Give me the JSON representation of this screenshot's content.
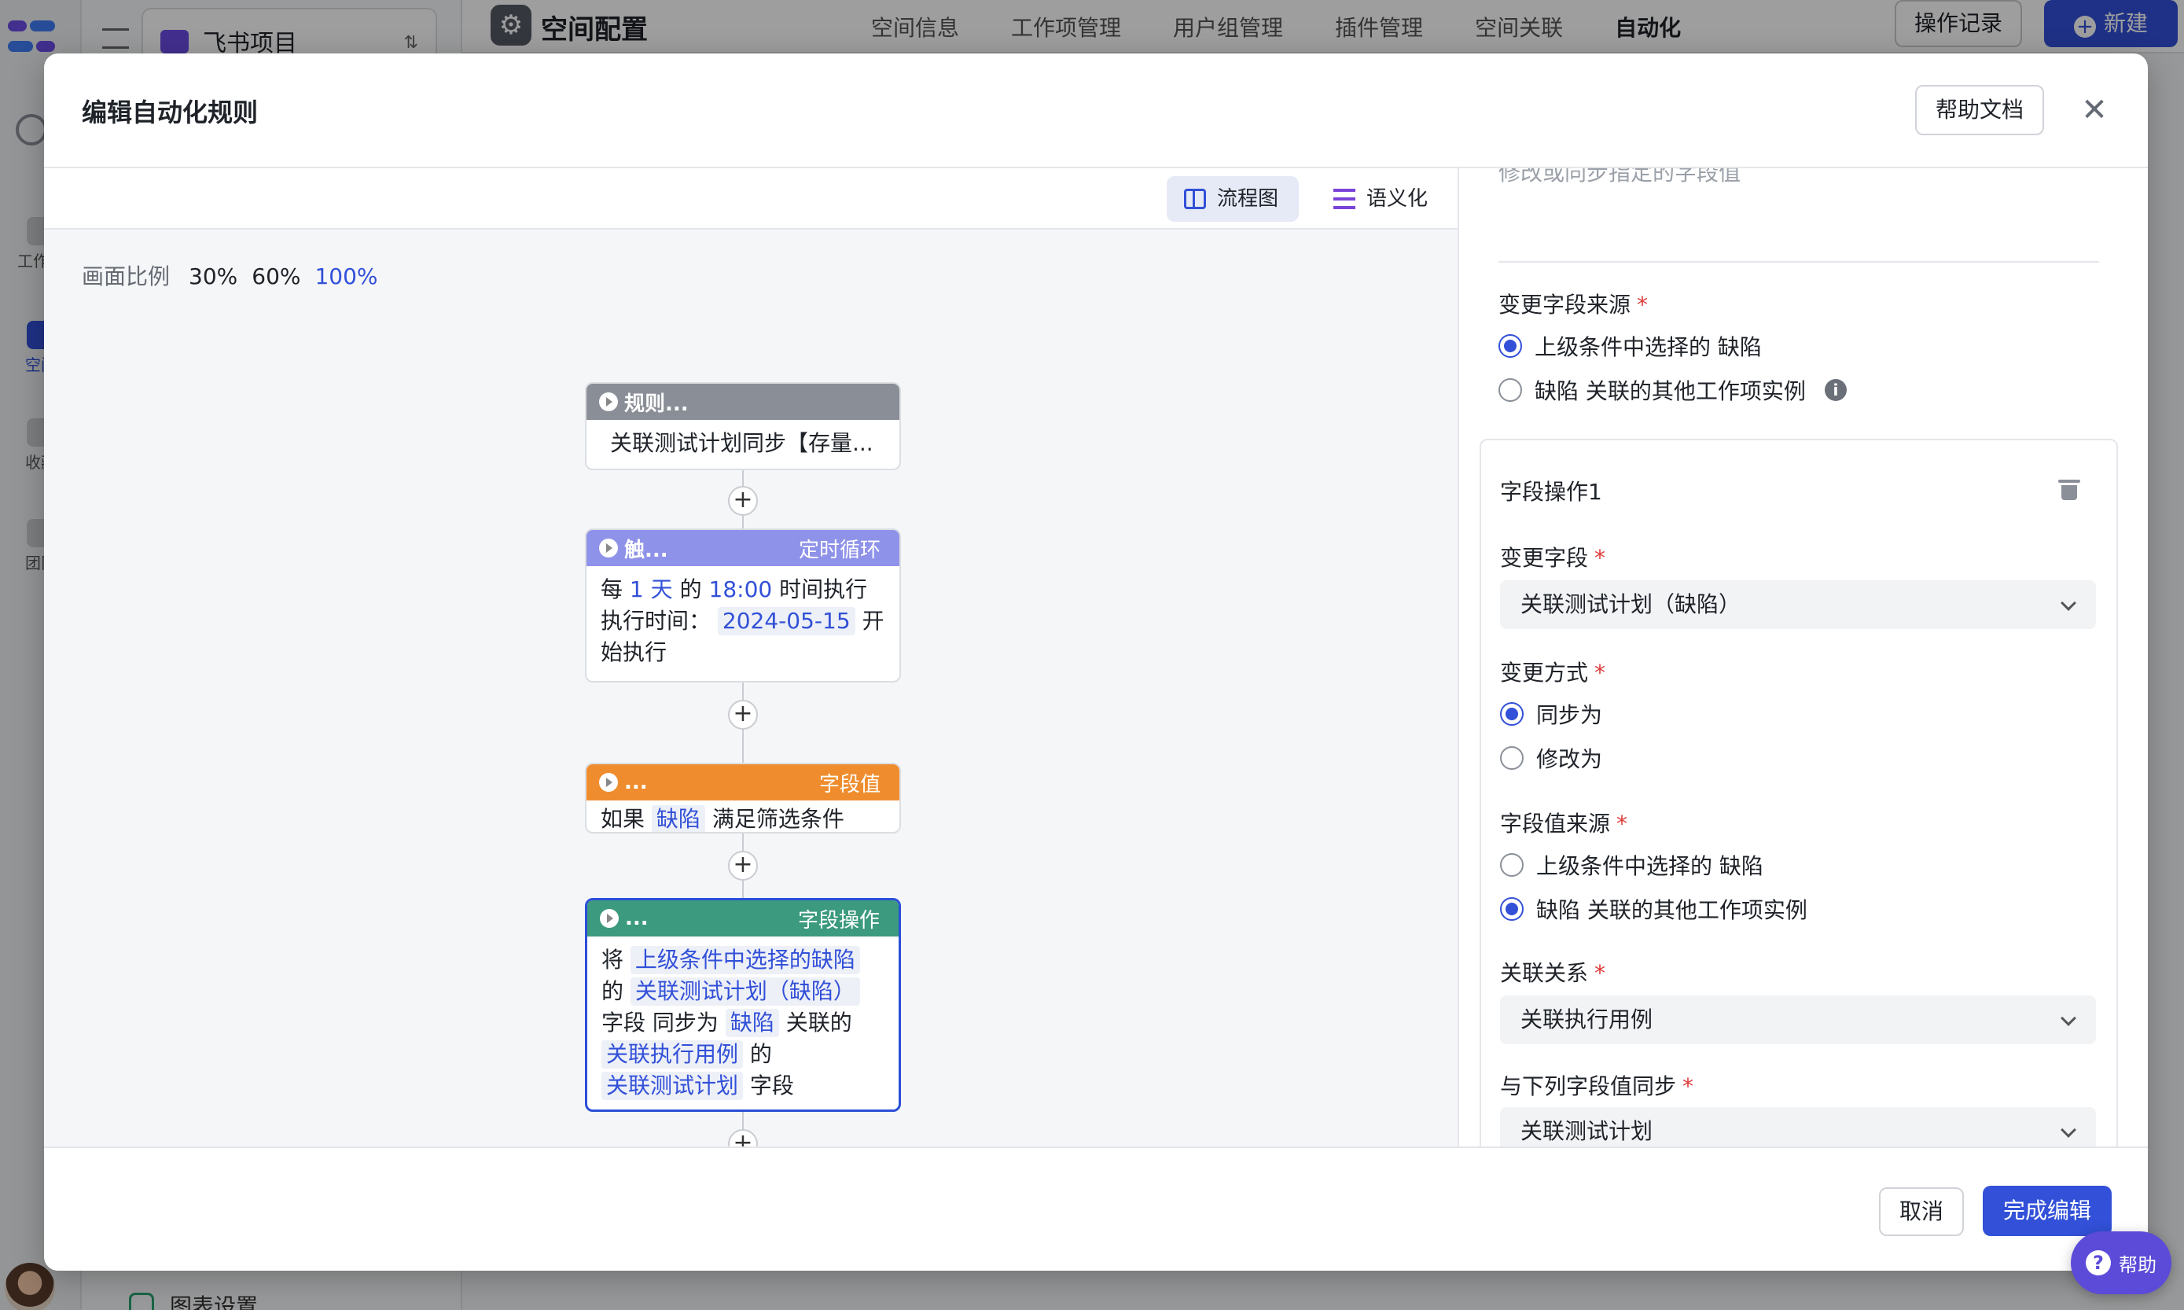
{
  "background": {
    "rail": [
      {
        "label": "工作台"
      },
      {
        "label": "空间"
      },
      {
        "label": "收藏"
      },
      {
        "label": "团队"
      }
    ],
    "project_name": "飞书项目",
    "sidebar_bottom_item": "图表设置",
    "page_title": "空间配置",
    "tabs": [
      {
        "label": "空间信息",
        "active": false
      },
      {
        "label": "工作项管理",
        "active": false
      },
      {
        "label": "用户组管理",
        "active": false
      },
      {
        "label": "插件管理",
        "active": false
      },
      {
        "label": "空间关联",
        "active": false
      },
      {
        "label": "自动化",
        "active": true
      }
    ],
    "op_log_button": "操作记录",
    "new_button": "新建"
  },
  "modal": {
    "title": "编辑自动化规则",
    "help_doc_button": "帮助文档",
    "view_toggle": {
      "flowchart": "流程图",
      "semantic": "语义化",
      "active": "flowchart"
    },
    "zoom": {
      "label": "画面比例",
      "options": [
        "30%",
        "60%",
        "100%"
      ],
      "active": "100%"
    },
    "nodes": {
      "rule": {
        "title": "规则...",
        "body": "关联测试计划同步【存量..."
      },
      "trigger": {
        "title": "触...",
        "tag": "定时循环",
        "t1": "每",
        "count": "1",
        "unit": "天",
        "t2": "的",
        "time": "18:00",
        "t3": "时间执行",
        "t4": "执行时间：",
        "date": "2024-05-15",
        "t5": "开始执行"
      },
      "condition": {
        "title": "...",
        "tag": "字段值",
        "t1": "如果",
        "item": "缺陷",
        "t2": "满足筛选条件"
      },
      "action": {
        "title": "...",
        "tag": "字段操作",
        "t1": "将",
        "c1": "上级条件中选择的缺陷",
        "t2": "的",
        "c2": "关联测试计划（缺陷）",
        "t3": "字段",
        "t4": "同步为",
        "c3": "缺陷",
        "t5": "关联的",
        "c4": "关联执行用例",
        "t6": "的",
        "c5": "关联测试计划",
        "t7": "字段"
      },
      "next": {
        "title": "..."
      }
    },
    "form": {
      "cut_text": "修改或同步指定的字段值",
      "source_label": "变更字段来源",
      "source_options": [
        {
          "prefix": "上级条件中选择的 ",
          "emph": "缺陷",
          "selected": true
        },
        {
          "prefix": "",
          "emph": "缺陷",
          "suffix": " 关联的其他工作项实例",
          "selected": false,
          "info": "i"
        }
      ],
      "op_card": {
        "title": "字段操作1",
        "field_label": "变更字段",
        "field_value": "关联测试计划（缺陷）",
        "mode_label": "变更方式",
        "mode_options": [
          {
            "label": "同步为",
            "selected": true
          },
          {
            "label": "修改为",
            "selected": false
          }
        ],
        "value_source_label": "字段值来源",
        "value_source_options": [
          {
            "prefix": "上级条件中选择的 ",
            "emph": "缺陷",
            "selected": false
          },
          {
            "prefix": "",
            "emph": "缺陷",
            "suffix": " 关联的其他工作项实例",
            "selected": true
          }
        ],
        "relation_label": "关联关系",
        "relation_value": "关联执行用例",
        "sync_label": "与下列字段值同步",
        "sync_value": "关联测试计划"
      },
      "required_mark": "*"
    },
    "footer": {
      "cancel": "取消",
      "done": "完成编辑"
    }
  },
  "help_button": "帮助"
}
